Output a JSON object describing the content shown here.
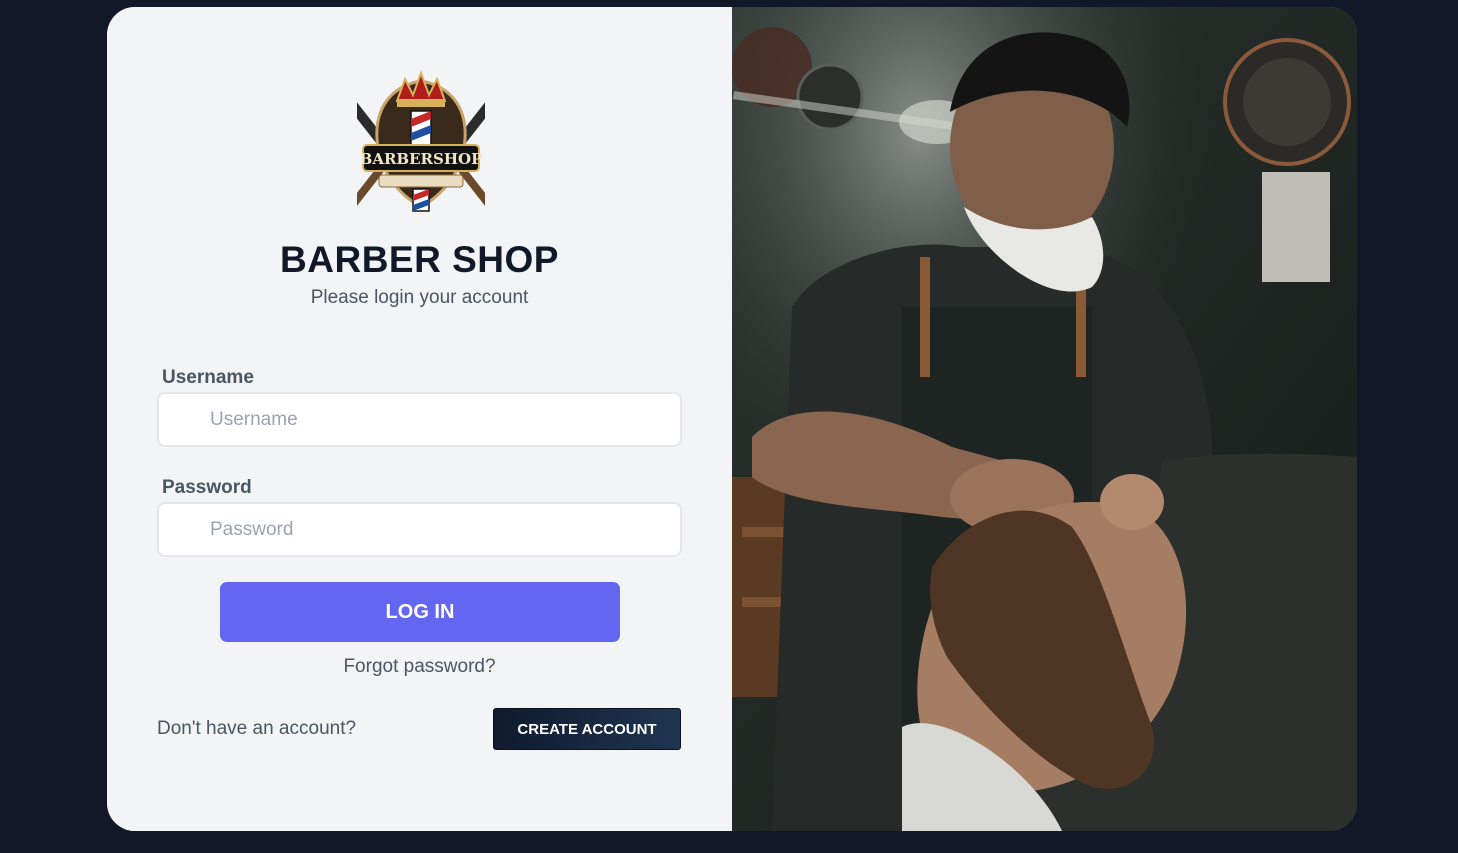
{
  "brand": {
    "logo_icon": "barbershop-logo",
    "title": "BARBER SHOP",
    "subtitle": "Please login your account"
  },
  "form": {
    "username": {
      "label": "Username",
      "placeholder": "Username",
      "value": ""
    },
    "password": {
      "label": "Password",
      "placeholder": "Password",
      "value": ""
    },
    "login_label": "LOG IN",
    "forgot_label": "Forgot password?"
  },
  "signup": {
    "prompt": "Don't have an account?",
    "button_label": "CREATE ACCOUNT"
  },
  "hero": {
    "image": "barber-trimming-beard-photo"
  },
  "colors": {
    "page_bg": "#111827",
    "panel_bg": "#f3f4f6",
    "primary": "#6366f1",
    "dark_button": "#0f1a2e",
    "title_text": "#111827",
    "muted_text": "#4b5563"
  }
}
